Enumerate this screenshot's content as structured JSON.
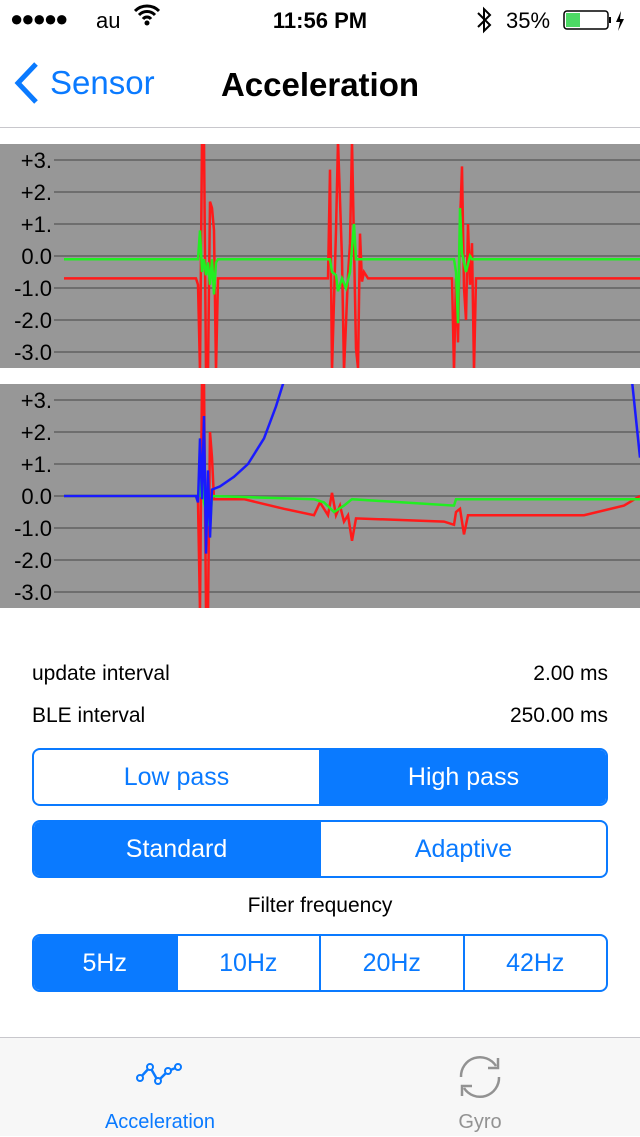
{
  "status_bar": {
    "carrier": "au",
    "time": "11:56 PM",
    "battery": "35%",
    "battery_level": 0.35
  },
  "nav": {
    "back_label": "Sensor",
    "title": "Acceleration"
  },
  "info": {
    "update_interval_label": "update interval",
    "update_interval_value": "2.00 ms",
    "ble_interval_label": "BLE interval",
    "ble_interval_value": "250.00 ms"
  },
  "filter_type": {
    "options": [
      "Low pass",
      "High pass"
    ],
    "selected": "High pass"
  },
  "filter_mode": {
    "options": [
      "Standard",
      "Adaptive"
    ],
    "selected": "Standard"
  },
  "filter_frequency": {
    "label": "Filter frequency",
    "options": [
      "5Hz",
      "10Hz",
      "20Hz",
      "42Hz"
    ],
    "selected": "5Hz"
  },
  "tabs": [
    {
      "label": "Acceleration",
      "icon": "line-chart-icon",
      "active": true
    },
    {
      "label": "Gyro",
      "icon": "refresh-icon",
      "active": false
    }
  ],
  "colors": {
    "accent": "#0a7aff",
    "chart_bg": "#979797",
    "x": "#ff1a1a",
    "y": "#22ee22",
    "z": "#1a1aff"
  },
  "chart_data": [
    {
      "type": "line",
      "ylim": [
        -3.5,
        3.5
      ],
      "xlim": [
        0,
        288
      ],
      "grid": true,
      "ytick_labels": [
        "+3.",
        "+2.",
        "+1.",
        "0.0",
        "-1.0",
        "-2.0",
        "-3.0"
      ],
      "yticks": [
        3,
        2,
        1,
        0,
        -1,
        -2,
        -3
      ],
      "series": [
        {
          "color": "#ff1a1a",
          "points": [
            [
              0,
              -0.7
            ],
            [
              66,
              -0.7
            ],
            [
              67,
              -0.9
            ],
            [
              68,
              -3.6
            ],
            [
              69,
              3.6
            ],
            [
              70,
              3.6
            ],
            [
              71,
              -3.6
            ],
            [
              72,
              -3.6
            ],
            [
              73,
              1.7
            ],
            [
              74,
              1.5
            ],
            [
              75,
              0.8
            ],
            [
              76,
              -3.6
            ],
            [
              77,
              -0.7
            ],
            [
              132,
              -0.7
            ],
            [
              133,
              2.7
            ],
            [
              134,
              -3.6
            ],
            [
              136,
              0.8
            ],
            [
              137,
              3.6
            ],
            [
              139,
              -0.1
            ],
            [
              140,
              -3.6
            ],
            [
              142,
              -0.6
            ],
            [
              143,
              0.4
            ],
            [
              144,
              3.6
            ],
            [
              146,
              -2.9
            ],
            [
              147,
              -3.5
            ],
            [
              148,
              0.7
            ],
            [
              149,
              -0.8
            ],
            [
              150,
              -0.5
            ],
            [
              152,
              -0.7
            ],
            [
              194,
              -0.7
            ],
            [
              195,
              -3.6
            ],
            [
              196,
              -0.7
            ],
            [
              197,
              -2.7
            ],
            [
              198,
              1.0
            ],
            [
              199,
              2.8
            ],
            [
              200,
              -1.0
            ],
            [
              201,
              -2.0
            ],
            [
              202,
              1.0
            ],
            [
              203,
              -0.9
            ],
            [
              204,
              0.4
            ],
            [
              205,
              -3.6
            ],
            [
              206,
              -0.7
            ],
            [
              288,
              -0.7
            ]
          ]
        },
        {
          "color": "#22ee22",
          "points": [
            [
              0,
              -0.1
            ],
            [
              67,
              -0.1
            ],
            [
              68,
              0.8
            ],
            [
              69,
              -0.5
            ],
            [
              70,
              -0.1
            ],
            [
              71,
              -0.6
            ],
            [
              72,
              -0.2
            ],
            [
              73,
              -0.9
            ],
            [
              74,
              -0.1
            ],
            [
              75,
              -1.2
            ],
            [
              76,
              -0.2
            ],
            [
              77,
              -0.1
            ],
            [
              133,
              -0.1
            ],
            [
              134,
              -0.5
            ],
            [
              136,
              -0.6
            ],
            [
              137,
              -1.1
            ],
            [
              139,
              -0.7
            ],
            [
              141,
              -1.0
            ],
            [
              143,
              -0.5
            ],
            [
              145,
              1.0
            ],
            [
              146,
              -0.1
            ],
            [
              195,
              -0.1
            ],
            [
              196,
              -0.5
            ],
            [
              197,
              -2.1
            ],
            [
              198,
              1.5
            ],
            [
              199,
              0.1
            ],
            [
              201,
              -0.5
            ],
            [
              203,
              0.0
            ],
            [
              204,
              -0.1
            ],
            [
              288,
              -0.1
            ]
          ]
        }
      ]
    },
    {
      "type": "line",
      "ylim": [
        -3.5,
        3.5
      ],
      "xlim": [
        0,
        288
      ],
      "grid": true,
      "ytick_labels": [
        "+3.",
        "+2.",
        "+1.",
        "0.0",
        "-1.0",
        "-2.0",
        "-3.0"
      ],
      "yticks": [
        3,
        2,
        1,
        0,
        -1,
        -2,
        -3
      ],
      "series": [
        {
          "color": "#ff1a1a",
          "points": [
            [
              0,
              0
            ],
            [
              66,
              0
            ],
            [
              67,
              -0.2
            ],
            [
              68,
              -3.6
            ],
            [
              69,
              3.6
            ],
            [
              70,
              3.6
            ],
            [
              71,
              -3.6
            ],
            [
              72,
              -3.6
            ],
            [
              73,
              2.0
            ],
            [
              74,
              1.2
            ],
            [
              75,
              -0.1
            ],
            [
              90,
              -0.1
            ],
            [
              110,
              -0.4
            ],
            [
              125,
              -0.6
            ],
            [
              128,
              -0.2
            ],
            [
              129,
              -0.3
            ],
            [
              132,
              -0.6
            ],
            [
              134,
              0.1
            ],
            [
              136,
              -0.6
            ],
            [
              138,
              -0.3
            ],
            [
              140,
              -0.8
            ],
            [
              142,
              -0.6
            ],
            [
              144,
              -1.4
            ],
            [
              146,
              -0.7
            ],
            [
              190,
              -0.8
            ],
            [
              195,
              -0.9
            ],
            [
              196,
              -0.5
            ],
            [
              198,
              -0.4
            ],
            [
              200,
              -1.2
            ],
            [
              202,
              -0.6
            ],
            [
              260,
              -0.6
            ],
            [
              280,
              -0.3
            ],
            [
              288,
              0
            ]
          ]
        },
        {
          "color": "#22ee22",
          "points": [
            [
              0,
              0
            ],
            [
              68,
              0
            ],
            [
              69,
              1.0
            ],
            [
              70,
              -0.2
            ],
            [
              73,
              -1.0
            ],
            [
              74,
              0
            ],
            [
              125,
              -0.1
            ],
            [
              130,
              -0.2
            ],
            [
              135,
              -0.5
            ],
            [
              140,
              -0.3
            ],
            [
              144,
              -0.1
            ],
            [
              195,
              -0.3
            ],
            [
              196,
              -0.1
            ],
            [
              198,
              -0.1
            ],
            [
              288,
              -0.1
            ]
          ]
        },
        {
          "color": "#1a1aff",
          "points": [
            [
              0,
              0
            ],
            [
              66,
              0
            ],
            [
              67,
              -0.2
            ],
            [
              68,
              1.8
            ],
            [
              69,
              -0.1
            ],
            [
              70,
              2.5
            ],
            [
              71,
              -1.8
            ],
            [
              72,
              0.8
            ],
            [
              73,
              -1.3
            ],
            [
              74,
              0.2
            ],
            [
              78,
              0.3
            ],
            [
              85,
              0.6
            ],
            [
              92,
              1.0
            ],
            [
              100,
              1.8
            ],
            [
              106,
              2.8
            ],
            [
              110,
              3.6
            ],
            [
              284,
              3.6
            ],
            [
              288,
              1.2
            ]
          ]
        }
      ]
    }
  ]
}
